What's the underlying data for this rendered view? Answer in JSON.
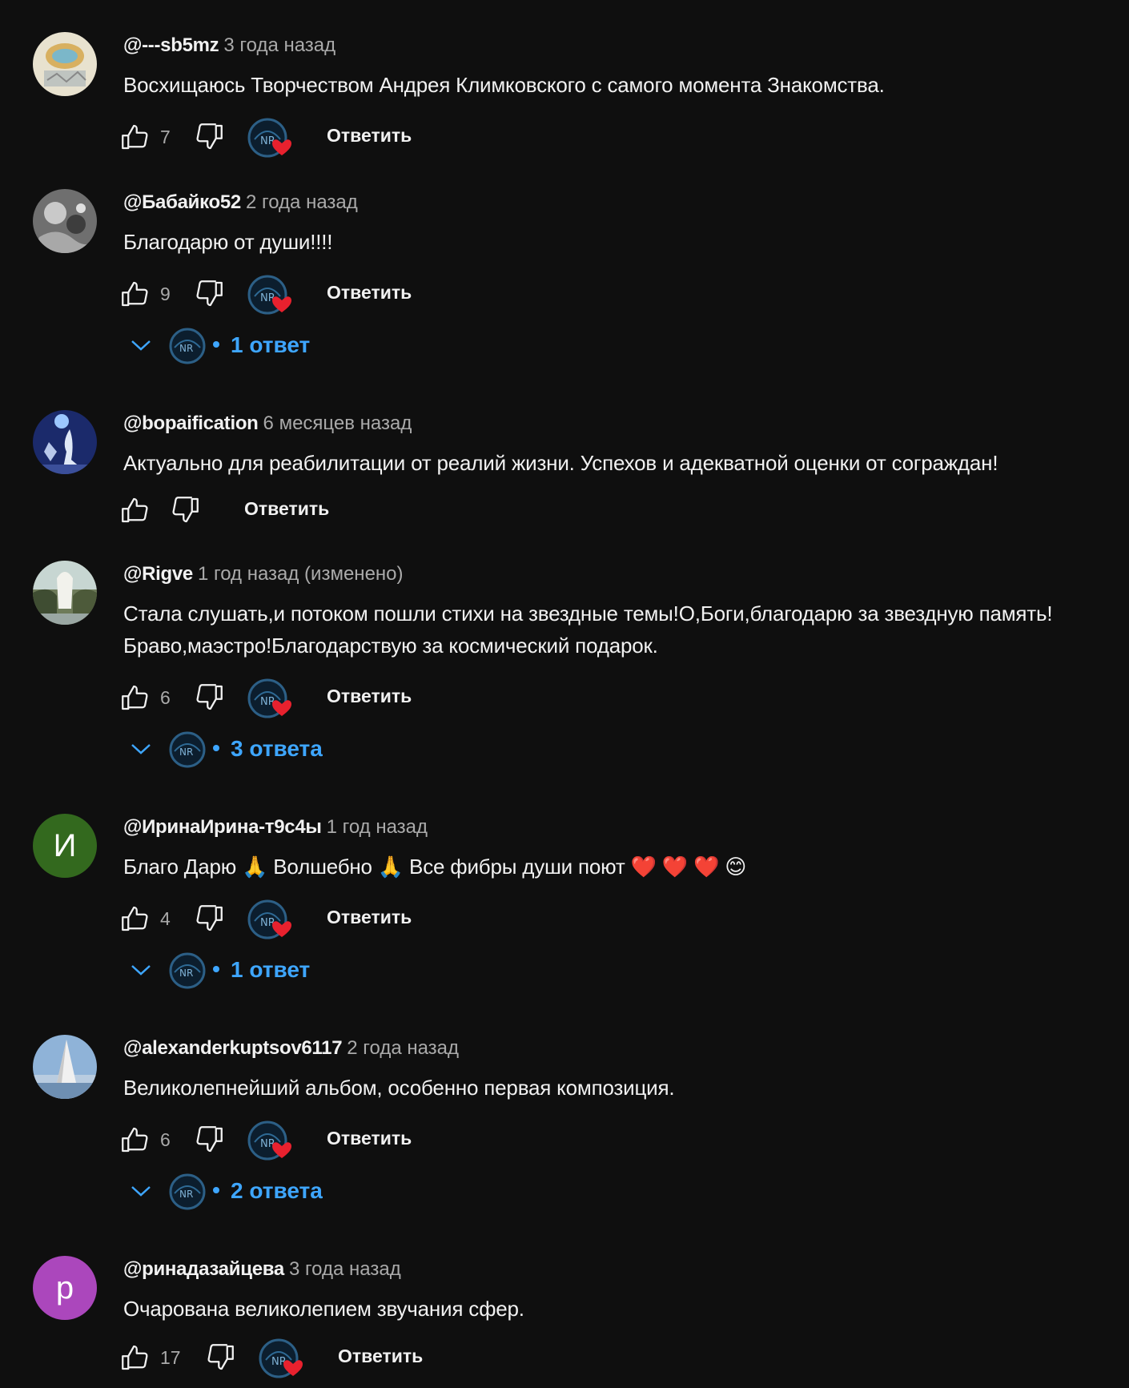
{
  "comments": [
    {
      "author": "@---sb5mz",
      "time": "3 года назад",
      "text": "Восхищаюсь Творчеством Андрея Климковского с самого момента Знакомства.",
      "likes": "7",
      "reply_label": "Ответить",
      "avatar": "photo-emblem",
      "hearted": true
    },
    {
      "author": "@Бабайко52",
      "time": "2 года назад",
      "text": "Благодарю от души!!!!",
      "likes": "9",
      "reply_label": "Ответить",
      "avatar": "photo-gray",
      "hearted": true,
      "replies": "1 ответ"
    },
    {
      "author": "@bopaification",
      "time": "6 месяцев назад",
      "text": "Актуально для реабилитации от реалий жизни. Успехов и адекватной оценки от сограждан!",
      "likes": "",
      "reply_label": "Ответить",
      "avatar": "photo-blue-figure",
      "hearted": false
    },
    {
      "author": "@Rigve",
      "time": "1 год назад (изменено)",
      "text": "Стала слушать,и потоком пошли стихи на звездные темы!О,Боги,благодарю за звездную память! Браво,маэстро!Благодарствую за космический подарок.",
      "likes": "6",
      "reply_label": "Ответить",
      "avatar": "photo-fountain",
      "hearted": true,
      "replies": "3 ответа"
    },
    {
      "author": "@ИринаИрина-т9с4ы",
      "time": "1 год назад",
      "text_parts": [
        "Благо Дарю ",
        "🙏",
        " Волшебно ",
        "🙏",
        " Все фибры души поют ",
        "❤️",
        " ",
        "❤️",
        " ",
        "❤️",
        " ",
        "😊"
      ],
      "likes": "4",
      "reply_label": "Ответить",
      "avatar_letter": "И",
      "avatar_color": "#33691e",
      "hearted": true,
      "replies": "1 ответ"
    },
    {
      "author": "@alexanderkuptsov6117",
      "time": "2 года назад",
      "text": "Великолепнейший альбом, особенно первая композиция.",
      "likes": "6",
      "reply_label": "Ответить",
      "avatar": "photo-sail",
      "hearted": true,
      "replies": "2 ответа"
    },
    {
      "author": "@ринадазайцева",
      "time": "3 года назад",
      "text": "Очарована великолепием звучания сфер.",
      "likes": "17",
      "reply_label": "Ответить",
      "avatar_letter": "р",
      "avatar_color": "#ab47bc",
      "hearted": true
    }
  ],
  "creator_avatar_initials": "NR",
  "colors": {
    "background": "#0f0f0f",
    "accent_blue": "#3ea6ff",
    "heart_red": "#e8212e",
    "secondary_text": "#aaaaaa"
  }
}
